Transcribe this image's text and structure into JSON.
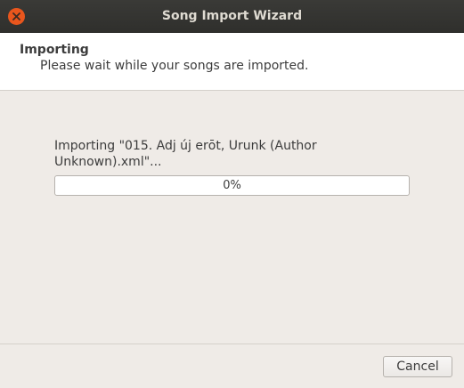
{
  "window": {
    "title": "Song Import Wizard"
  },
  "header": {
    "title": "Importing",
    "subtitle": "Please wait while your songs are imported."
  },
  "main": {
    "status_text": "Importing \"015. Adj új erōt, Urunk (Author Unknown).xml\"...",
    "progress_label": "0%",
    "progress_value": 0
  },
  "footer": {
    "cancel_label": "Cancel"
  },
  "colors": {
    "titlebar": "#2f2f2c",
    "close_button": "#e9561d",
    "window_background": "#efebe7",
    "header_background": "#ffffff"
  }
}
